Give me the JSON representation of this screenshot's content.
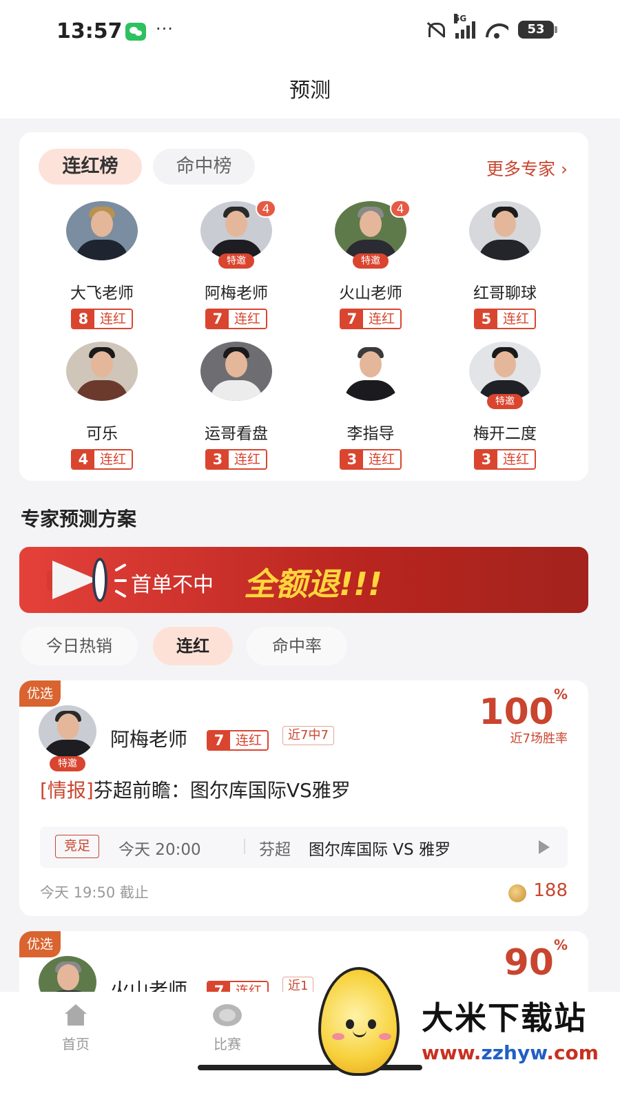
{
  "status_bar": {
    "time": "13:57",
    "dots": "···",
    "network": "5G",
    "battery": "53"
  },
  "header": {
    "title": "预测"
  },
  "ranking": {
    "tabs": [
      {
        "label": "连红榜",
        "active": true
      },
      {
        "label": "命中榜",
        "active": false
      }
    ],
    "more_label": "更多专家 ›",
    "experts": [
      {
        "name": "大飞老师",
        "streak": "8",
        "streak_label": "连红",
        "badge": null,
        "invited": null
      },
      {
        "name": "阿梅老师",
        "streak": "7",
        "streak_label": "连红",
        "badge": "4",
        "invited": "特邀"
      },
      {
        "name": "火山老师",
        "streak": "7",
        "streak_label": "连红",
        "badge": "4",
        "invited": "特邀"
      },
      {
        "name": "红哥聊球",
        "streak": "5",
        "streak_label": "连红",
        "badge": null,
        "invited": null
      },
      {
        "name": "可乐",
        "streak": "4",
        "streak_label": "连红",
        "badge": null,
        "invited": null
      },
      {
        "name": "运哥看盘",
        "streak": "3",
        "streak_label": "连红",
        "badge": null,
        "invited": null
      },
      {
        "name": "李指导",
        "streak": "3",
        "streak_label": "连红",
        "badge": null,
        "invited": null
      },
      {
        "name": "梅开二度",
        "streak": "3",
        "streak_label": "连红",
        "badge": null,
        "invited": "特邀"
      }
    ]
  },
  "section_title": "专家预测方案",
  "banner": {
    "text": "首单不中",
    "highlight": "全额退!!!"
  },
  "filters": [
    {
      "label": "今日热销",
      "active": false
    },
    {
      "label": "连红",
      "active": true
    },
    {
      "label": "命中率",
      "active": false
    }
  ],
  "plans": [
    {
      "pick_tag": "优选",
      "name": "阿梅老师",
      "invited": "特邀",
      "streak": "7",
      "streak_label": "连红",
      "recent": "近7中7",
      "rate": "100",
      "rate_unit": "%",
      "rate_label": "近7场胜率",
      "title_tag": "[情报]",
      "title": "芬超前瞻：图尔库国际VS雅罗",
      "league_tag": "竞足",
      "match_time": "今天 20:00",
      "league": "芬超",
      "teams": "图尔库国际 VS 雅罗",
      "deadline": "今天 19:50 截止",
      "price": "188"
    },
    {
      "pick_tag": "优选",
      "name": "火山老师",
      "streak": "7",
      "streak_label": "连红",
      "recent": "近1",
      "rate": "90",
      "rate_unit": "%"
    }
  ],
  "tabbar": [
    {
      "label": "首页",
      "icon": "home-icon"
    },
    {
      "label": "比赛",
      "icon": "ball-icon"
    }
  ],
  "watermark": {
    "title": "大米下载站",
    "url_prefix": "www.",
    "url_main": "zzhyw",
    "url_suffix": ".com"
  },
  "colors": {
    "accent": "#d9452f",
    "banner_yellow": "#ffd63c",
    "pick_tag": "#d9642f"
  }
}
